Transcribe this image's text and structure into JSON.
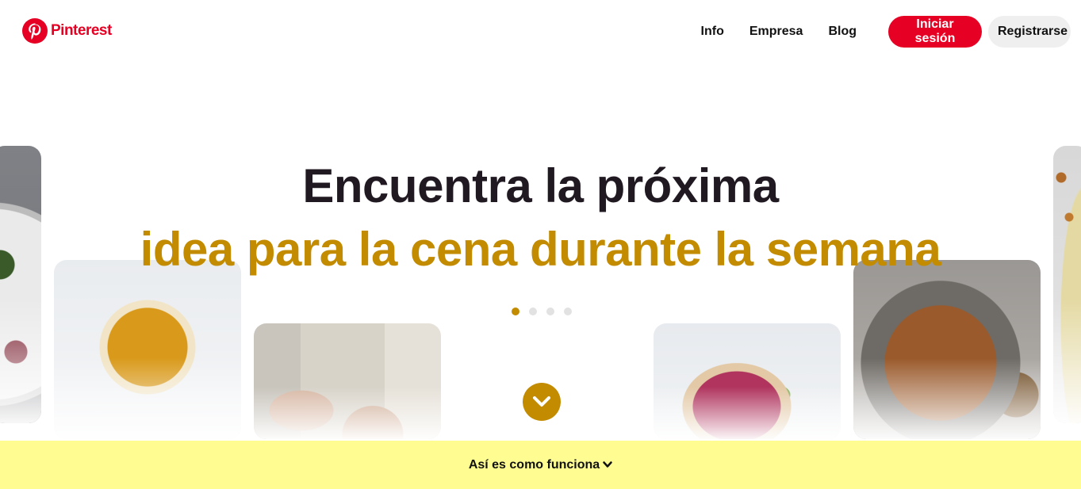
{
  "brand": {
    "name": "Pinterest",
    "color": "#e60023"
  },
  "nav": {
    "links": [
      "Info",
      "Empresa",
      "Blog"
    ],
    "login_label": "Iniciar sesión",
    "signup_label": "Registrarse"
  },
  "hero": {
    "title": "Encuentra la próxima",
    "subtitle": "idea para la cena durante la semana",
    "accent_color": "#c28b00",
    "carousel_dots": 4,
    "active_dot": 1
  },
  "bottom_bar": {
    "label": "Así es como funciona",
    "background": "#fffd92"
  },
  "icons": [
    "pinterest-logo-icon",
    "chevron-down-icon"
  ]
}
